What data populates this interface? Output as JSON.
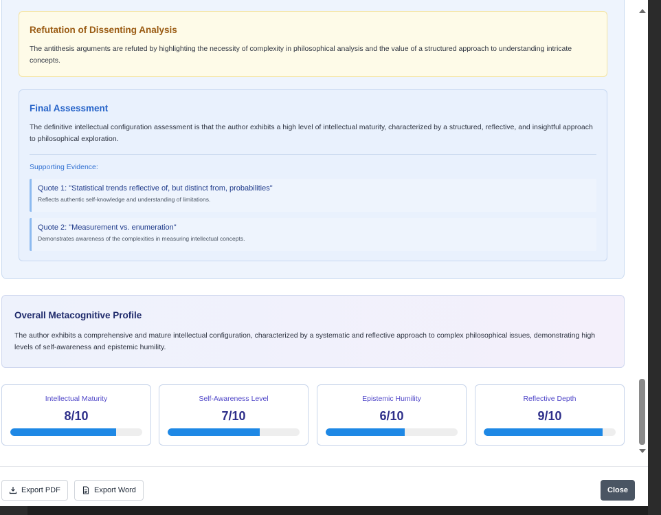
{
  "refutation": {
    "title": "Refutation of Dissenting Analysis",
    "text": "The antithesis arguments are refuted by highlighting the necessity of complexity in philosophical analysis and the value of a structured approach to understanding intricate concepts."
  },
  "final_assessment": {
    "title": "Final Assessment",
    "text": "The definitive intellectual configuration assessment is that the author exhibits a high level of intellectual maturity, characterized by a structured, reflective, and insightful approach to philosophical exploration.",
    "supporting_title": "Supporting Evidence:",
    "quotes": [
      {
        "title": "Quote 1: \"Statistical trends reflective of, but distinct from, probabilities\"",
        "desc": "Reflects authentic self-knowledge and understanding of limitations."
      },
      {
        "title": "Quote 2: \"Measurement vs. enumeration\"",
        "desc": "Demonstrates awareness of the complexities in measuring intellectual concepts."
      }
    ]
  },
  "profile": {
    "title": "Overall Metacognitive Profile",
    "text": "The author exhibits a comprehensive and mature intellectual configuration, characterized by a systematic and reflective approach to complex philosophical issues, demonstrating high levels of self-awareness and epistemic humility."
  },
  "metrics": [
    {
      "label": "Intellectual Maturity",
      "value": "8/10",
      "fraction": 0.8
    },
    {
      "label": "Self-Awareness Level",
      "value": "7/10",
      "fraction": 0.7
    },
    {
      "label": "Epistemic Humility",
      "value": "6/10",
      "fraction": 0.6
    },
    {
      "label": "Reflective Depth",
      "value": "9/10",
      "fraction": 0.9
    }
  ],
  "footer": {
    "export_pdf": "Export PDF",
    "export_word": "Export Word",
    "close": "Close"
  },
  "colors": {
    "bar_fill": "#1e88e5",
    "close_bg": "#4a5563"
  }
}
